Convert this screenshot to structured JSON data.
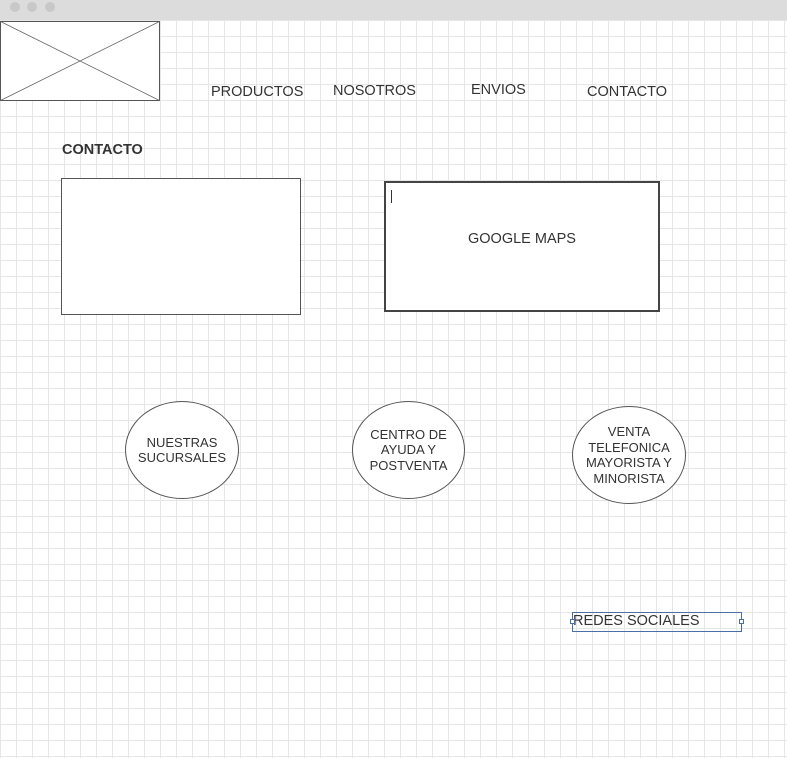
{
  "nav": {
    "items": [
      {
        "label": "PRODUCTOS"
      },
      {
        "label": "NOSOTROS"
      },
      {
        "label": "ENVIOS"
      },
      {
        "label": "CONTACTO"
      }
    ]
  },
  "page": {
    "title": "CONTACTO"
  },
  "map": {
    "label": "GOOGLE MAPS"
  },
  "circles": [
    {
      "label": "NUESTRAS SUCURSALES"
    },
    {
      "label": "CENTRO DE AYUDA Y POSTVENTA"
    },
    {
      "label": "VENTA TELEFONICA MAYORISTA Y MINORISTA"
    }
  ],
  "social": {
    "label": "REDES SOCIALES"
  },
  "colors": {
    "grid": "#e6e6e6",
    "text": "#333333",
    "titlebar": "#dcdcdc",
    "selection": "#4a6fa5"
  }
}
